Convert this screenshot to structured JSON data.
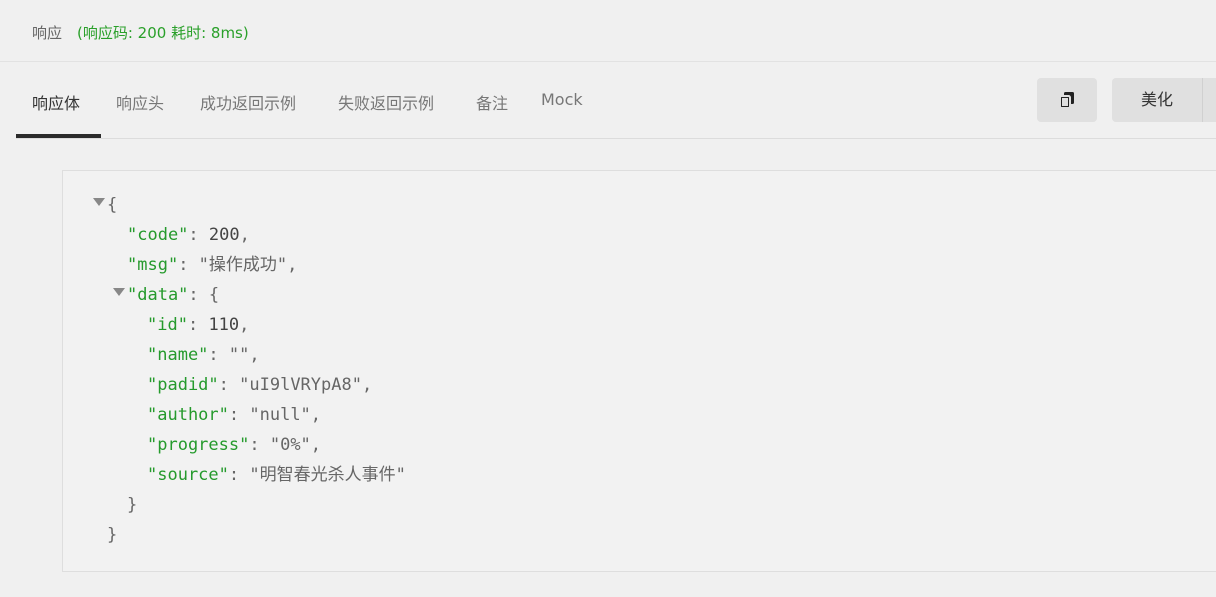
{
  "status": {
    "title": "响应",
    "detail": "(响应码: 200 耗时: 8ms)"
  },
  "tabs": [
    {
      "label": "响应体",
      "active": true
    },
    {
      "label": "响应头",
      "active": false
    },
    {
      "label": "成功返回示例",
      "active": false
    },
    {
      "label": "失败返回示例",
      "active": false
    },
    {
      "label": "备注",
      "active": false
    },
    {
      "label": "Mock",
      "active": false
    }
  ],
  "toolbar": {
    "copy_icon": "copy-icon",
    "beautify_label": "美化"
  },
  "json": {
    "open_brace": "{",
    "close_brace": "}",
    "code_key": "\"code\"",
    "code_value": "200",
    "msg_key": "\"msg\"",
    "msg_value": "\"操作成功\"",
    "data_key": "\"data\"",
    "data_open": "{",
    "data_close": "}",
    "id_key": "\"id\"",
    "id_value": "110",
    "name_key": "\"name\"",
    "name_value": "\"\"",
    "padid_key": "\"padid\"",
    "padid_value": "\"uI9lVRYpA8\"",
    "author_key": "\"author\"",
    "author_value": "\"null\"",
    "progress_key": "\"progress\"",
    "progress_value": "\"0%\"",
    "source_key": "\"source\"",
    "source_value": "\"明智春光杀人事件\""
  },
  "colors": {
    "key": "#259a2c",
    "status_detail": "#2aa02a",
    "active_tab_underline": "#2b2b2b"
  }
}
